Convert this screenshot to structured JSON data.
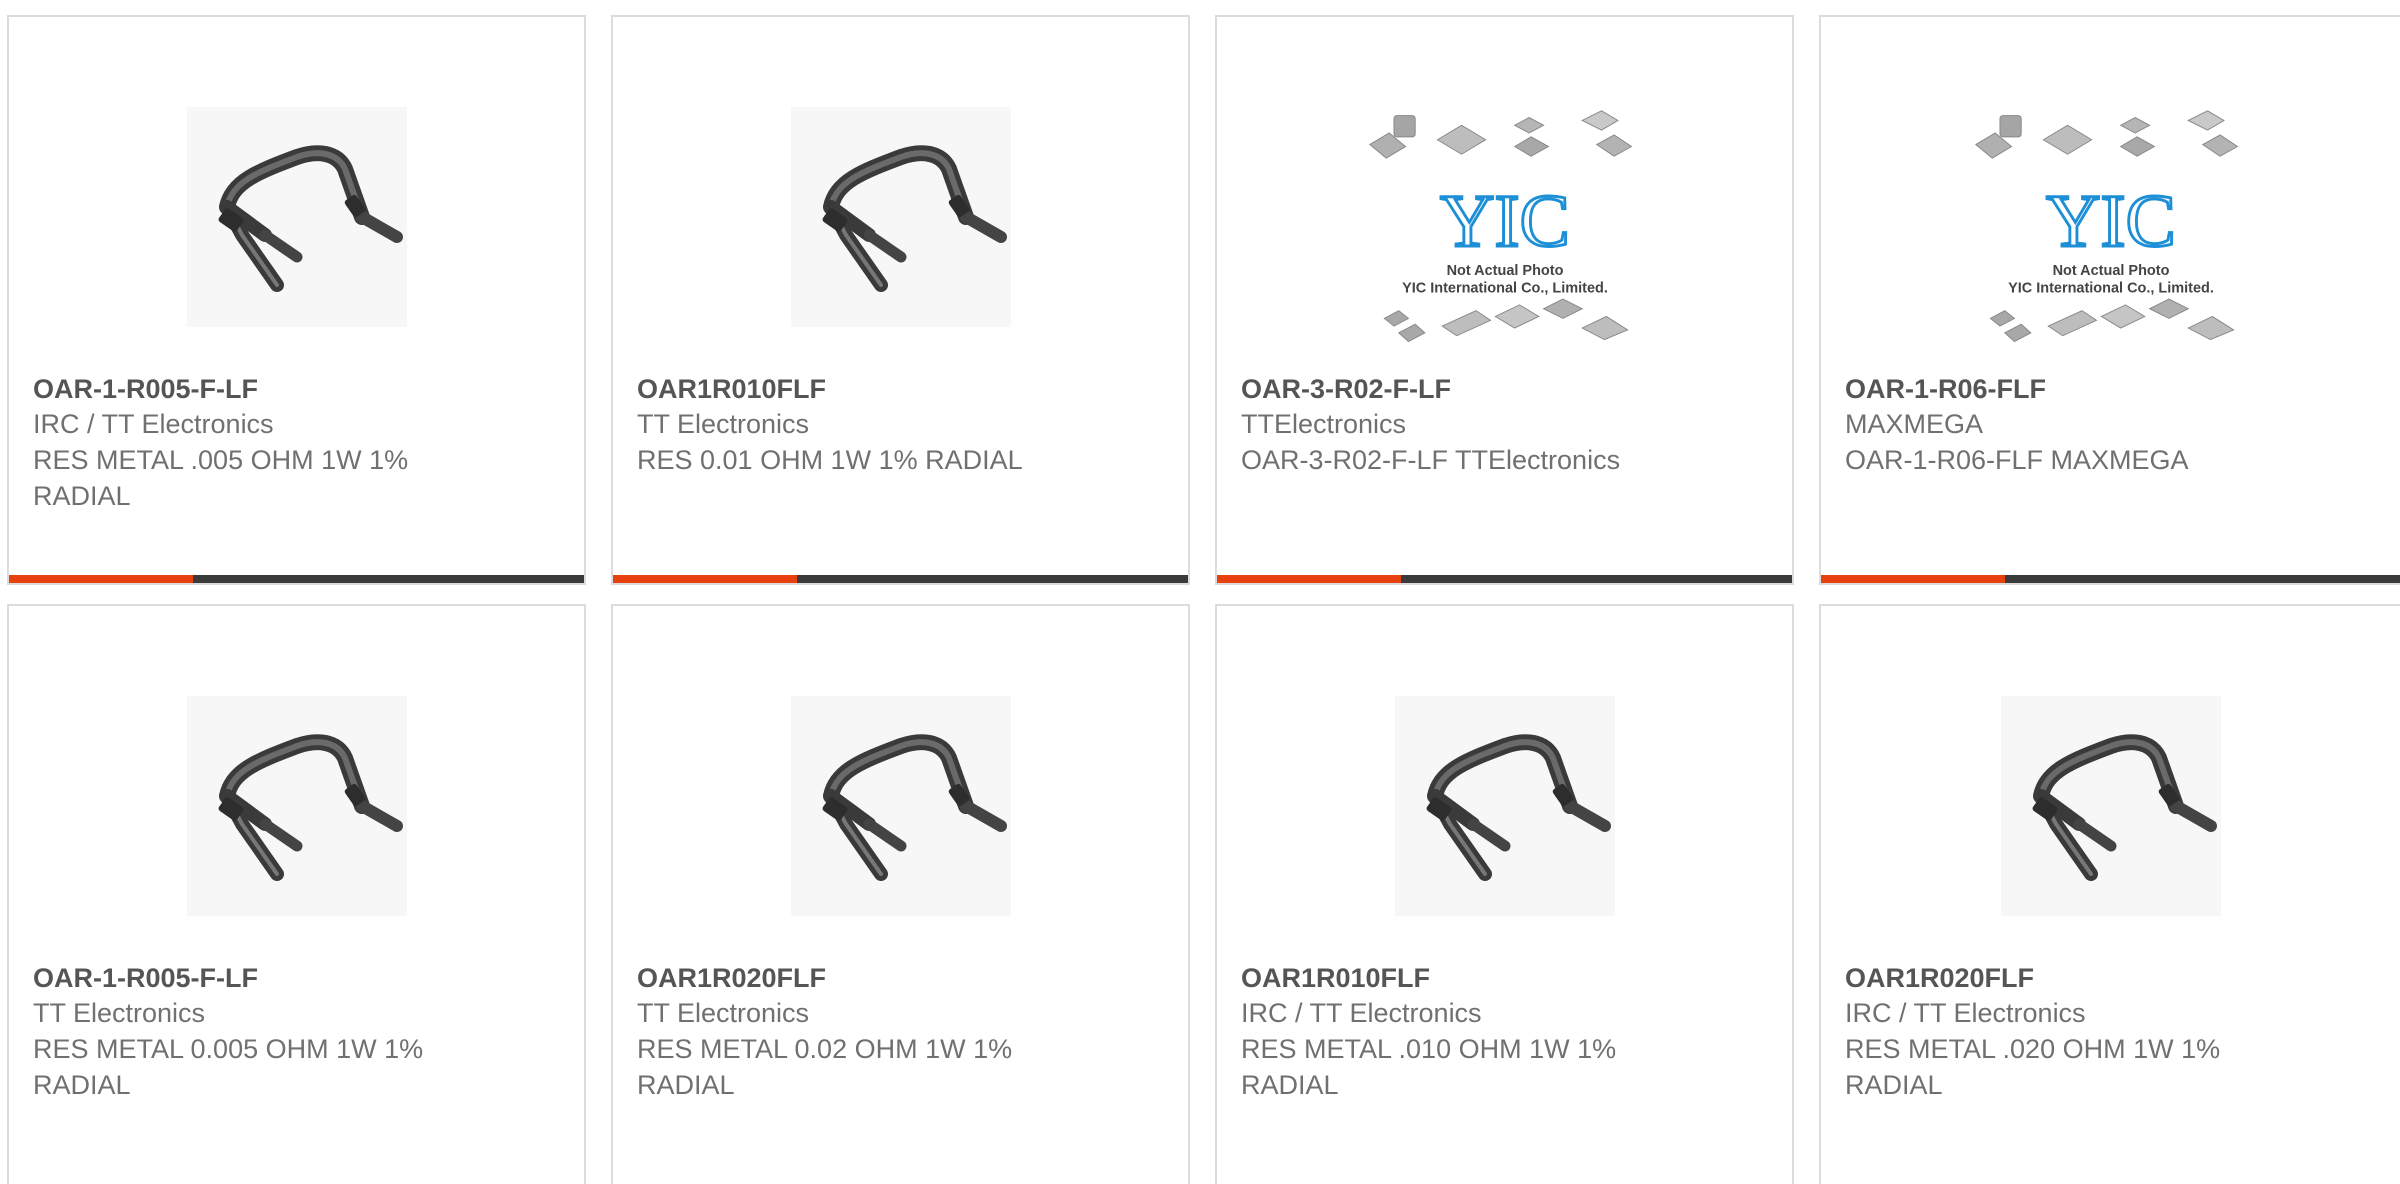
{
  "colors": {
    "accent": "#e8410f",
    "bar_dark": "#3b3b3b",
    "border": "#dcdcdc",
    "part_text": "#555555",
    "secondary_text": "#707070"
  },
  "yic_placeholder": {
    "logo": "YIC",
    "line1": "Not Actual Photo",
    "line2": "YIC International Co., Limited."
  },
  "products": [
    {
      "part": "OAR-1-R005-F-LF",
      "manufacturer": "IRC / TT Electronics",
      "description": "RES METAL .005 OHM 1W 1% RADIAL",
      "image": "resistor-photo"
    },
    {
      "part": "OAR1R010FLF",
      "manufacturer": "TT Electronics",
      "description": "RES 0.01 OHM 1W 1% RADIAL",
      "image": "resistor-photo"
    },
    {
      "part": "OAR-3-R02-F-LF",
      "manufacturer": "TTElectronics",
      "description": "OAR-3-R02-F-LF TTElectronics",
      "image": "yic-placeholder"
    },
    {
      "part": "OAR-1-R06-FLF",
      "manufacturer": "MAXMEGA",
      "description": "OAR-1-R06-FLF MAXMEGA",
      "image": "yic-placeholder"
    },
    {
      "part": "OAR-1-R005-F-LF",
      "manufacturer": "TT Electronics",
      "description": "RES METAL 0.005 OHM 1W 1% RADIAL",
      "image": "resistor-photo"
    },
    {
      "part": "OAR1R020FLF",
      "manufacturer": "TT Electronics",
      "description": "RES METAL 0.02 OHM 1W 1% RADIAL",
      "image": "resistor-photo"
    },
    {
      "part": "OAR1R010FLF",
      "manufacturer": "IRC / TT Electronics",
      "description": "RES METAL .010 OHM 1W 1% RADIAL",
      "image": "resistor-photo"
    },
    {
      "part": "OAR1R020FLF",
      "manufacturer": "IRC / TT Electronics",
      "description": "RES METAL .020 OHM 1W 1% RADIAL",
      "image": "resistor-photo"
    }
  ]
}
